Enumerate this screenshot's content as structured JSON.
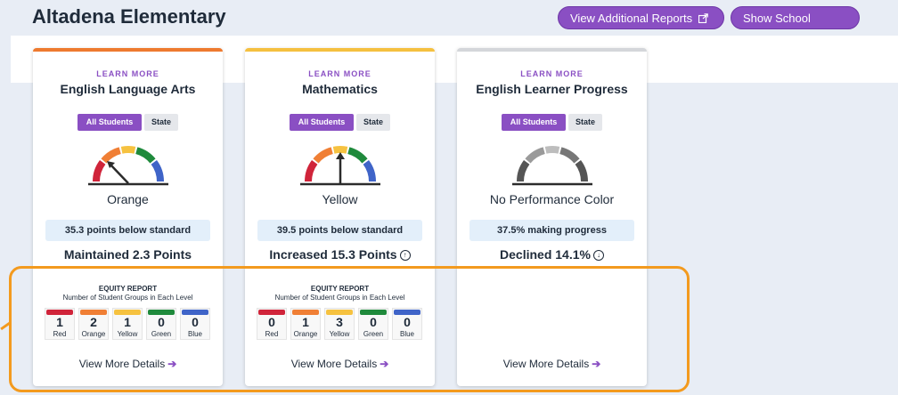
{
  "header": {
    "school_name": "Altadena Elementary",
    "reports_button": "View Additional Reports",
    "reports_icon": "external-link-icon",
    "details_button": "Show School Details"
  },
  "toggle": {
    "all_students": "All Students",
    "state": "State"
  },
  "cards": [
    {
      "learn_more": "LEARN MORE",
      "title": "English Language Arts",
      "accent": "#ee7a2f",
      "performance_color": "Orange",
      "status": "35.3 points below standard",
      "change": "Maintained 2.3 Points",
      "equity": {
        "heading": "EQUITY REPORT",
        "subheading": "Number of Student Groups in Each Level",
        "levels": [
          {
            "label": "Red",
            "count": "1",
            "color": "#d0243a"
          },
          {
            "label": "Orange",
            "count": "2",
            "color": "#f07f35"
          },
          {
            "label": "Yellow",
            "count": "1",
            "color": "#f6c240"
          },
          {
            "label": "Green",
            "count": "0",
            "color": "#1f8a3c"
          },
          {
            "label": "Blue",
            "count": "0",
            "color": "#3f64c8"
          }
        ]
      },
      "view_more": "View More Details"
    },
    {
      "learn_more": "LEARN MORE",
      "title": "Mathematics",
      "accent": "#f5c040",
      "performance_color": "Yellow",
      "status": "39.5 points below standard",
      "change": "Increased 15.3 Points",
      "equity": {
        "heading": "EQUITY REPORT",
        "subheading": "Number of Student Groups in Each Level",
        "levels": [
          {
            "label": "Red",
            "count": "0",
            "color": "#d0243a"
          },
          {
            "label": "Orange",
            "count": "1",
            "color": "#f07f35"
          },
          {
            "label": "Yellow",
            "count": "3",
            "color": "#f6c240"
          },
          {
            "label": "Green",
            "count": "0",
            "color": "#1f8a3c"
          },
          {
            "label": "Blue",
            "count": "0",
            "color": "#3f64c8"
          }
        ]
      },
      "view_more": "View More Details"
    },
    {
      "learn_more": "LEARN MORE",
      "title": "English Learner Progress",
      "accent": "#d4d6da",
      "performance_color": "No Performance Color",
      "status": "37.5% making progress",
      "change": "Declined 14.1%",
      "view_more": "View More Details"
    }
  ],
  "colors": {
    "brand_purple": "#8a4fc3",
    "highlight_orange": "#f39a1e"
  }
}
